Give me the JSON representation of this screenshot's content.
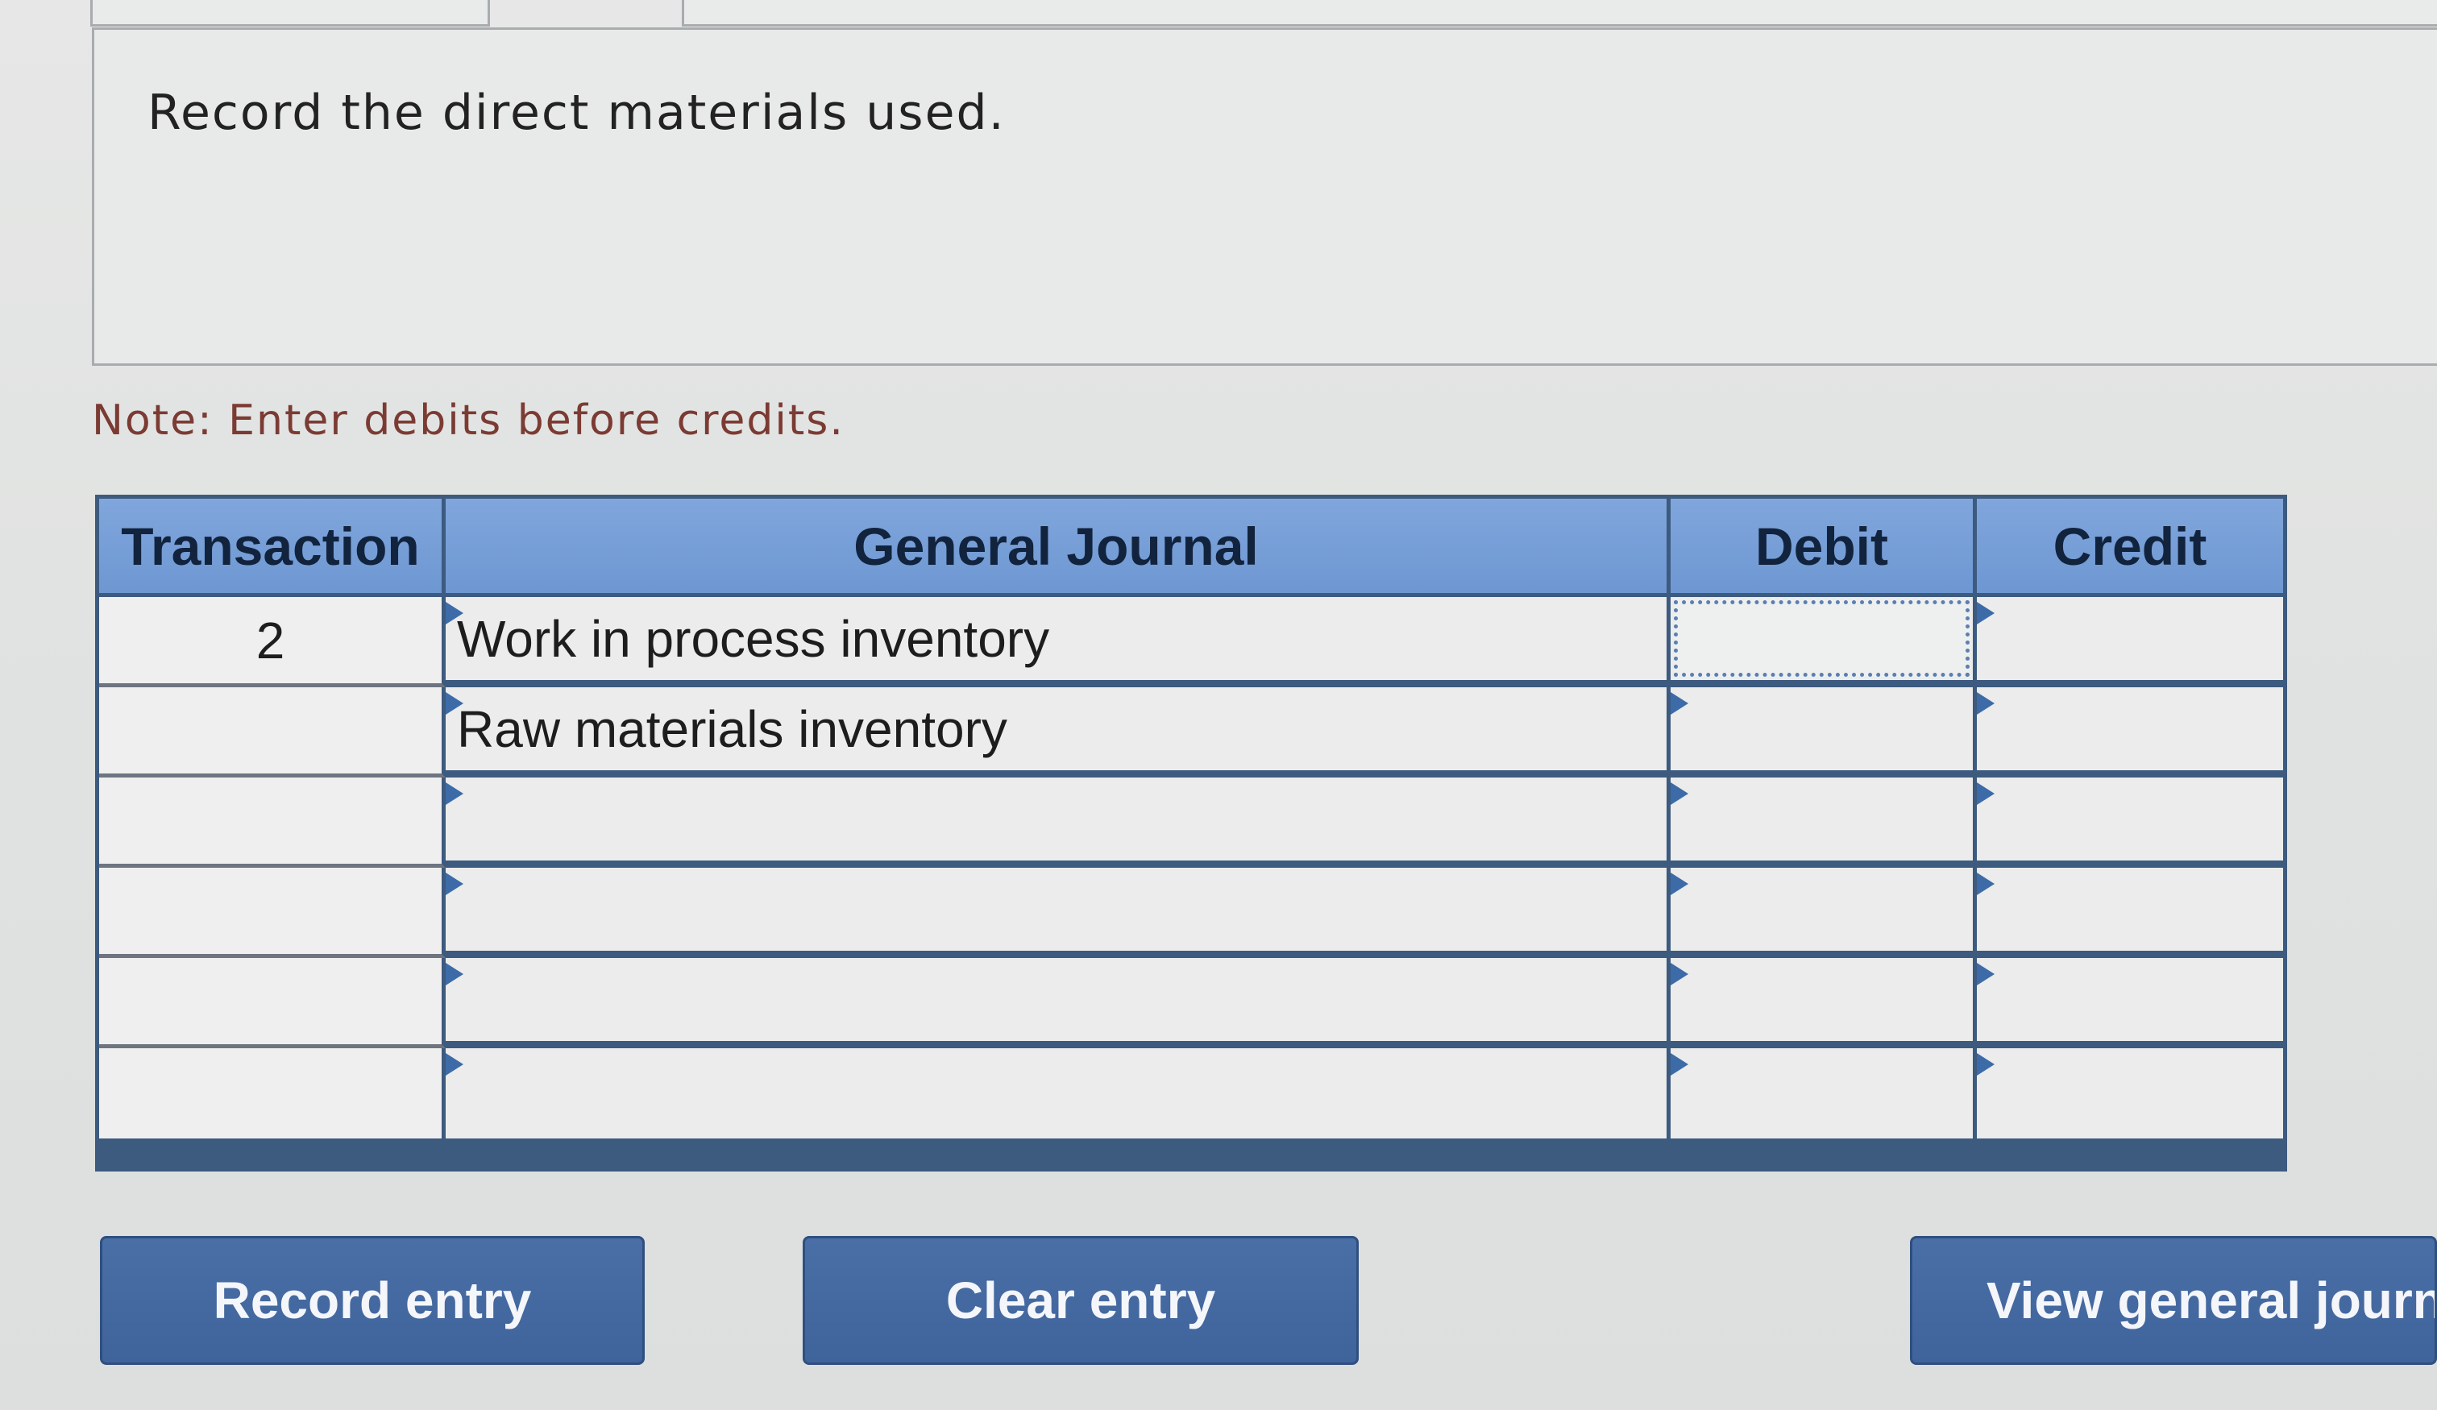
{
  "instruction": "Record the direct materials used.",
  "note": "Note: Enter debits before credits.",
  "journal": {
    "headers": {
      "transaction": "Transaction",
      "general_journal": "General Journal",
      "debit": "Debit",
      "credit": "Credit"
    },
    "rows": [
      {
        "transaction": "2",
        "account": "Work in process inventory",
        "debit": "",
        "credit": ""
      },
      {
        "transaction": "",
        "account": "Raw materials inventory",
        "debit": "",
        "credit": ""
      },
      {
        "transaction": "",
        "account": "",
        "debit": "",
        "credit": ""
      },
      {
        "transaction": "",
        "account": "",
        "debit": "",
        "credit": ""
      },
      {
        "transaction": "",
        "account": "",
        "debit": "",
        "credit": ""
      },
      {
        "transaction": "",
        "account": "",
        "debit": "",
        "credit": ""
      }
    ]
  },
  "buttons": {
    "record": "Record entry",
    "clear": "Clear entry",
    "view": "View general journa"
  },
  "colors": {
    "header_blue": "#76a0d8",
    "grid_border": "#3d5a7f",
    "button_blue": "#4569a1",
    "note_text": "#7b3b33"
  }
}
